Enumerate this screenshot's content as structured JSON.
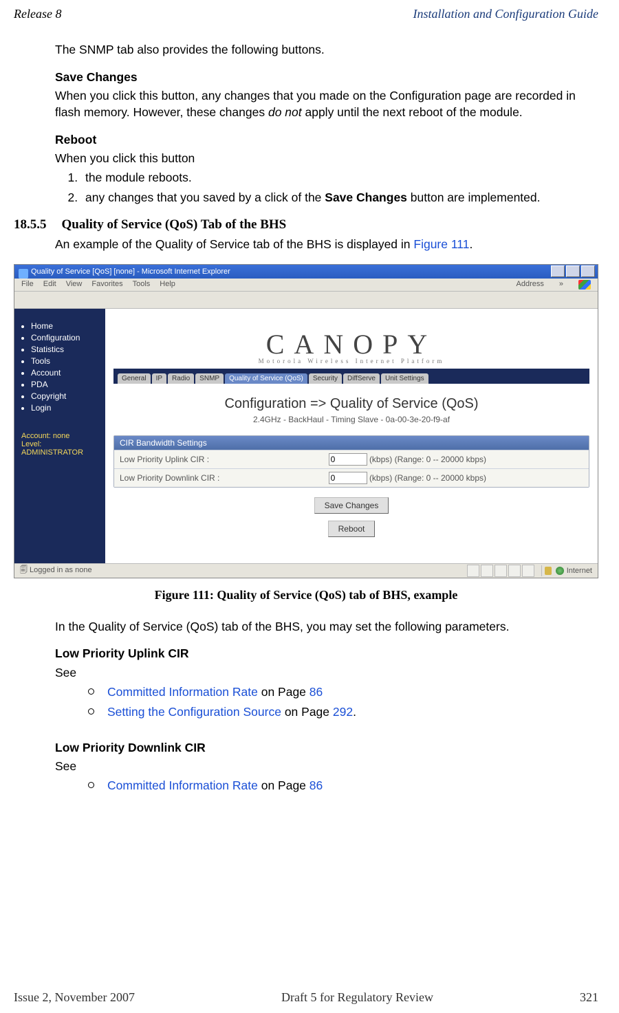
{
  "header": {
    "left": "Release 8",
    "right": "Installation and Configuration Guide"
  },
  "footer": {
    "left": "Issue 2, November 2007",
    "center": "Draft 5 for Regulatory Review",
    "right": "321"
  },
  "p1": "The SNMP tab also provides the following buttons.",
  "sh_save": "Save Changes",
  "p_save_a": "When you click this button, any changes that you made on the Configuration page are recorded in flash memory. However, these changes ",
  "p_save_i": "do not",
  "p_save_b": " apply until the next reboot of the module.",
  "sh_reboot": "Reboot",
  "p_reboot_intro": "When you click this button",
  "ol1": "the module reboots.",
  "ol2_a": "any changes that you saved by a click of the ",
  "ol2_b": "Save Changes",
  "ol2_c": " button are implemented.",
  "secnum": "18.5.5",
  "sectitle": "Quality of Service (QoS) Tab of the BHS",
  "p_sec_a": "An example of the Quality of Service tab of the BHS is displayed in ",
  "p_sec_link": "Figure 111",
  "p_sec_b": ".",
  "figcap": "Figure 111: Quality of Service (QoS) tab of BHS, example",
  "p_after": "In the Quality of Service (QoS) tab of the BHS, you may set the following parameters.",
  "sh_lpu": "Low Priority Uplink CIR",
  "see": "See",
  "b1_link": "Committed Information Rate",
  "b1_txt": " on Page ",
  "b1_pg": "86",
  "b2_link": "Setting the Configuration Source",
  "b2_txt": " on Page ",
  "b2_pg": "292",
  "period": ".",
  "sh_lpd": "Low Priority Downlink CIR",
  "ie": {
    "title": "Quality of Service [QoS] [none] - Microsoft Internet Explorer",
    "menu": [
      "File",
      "Edit",
      "View",
      "Favorites",
      "Tools",
      "Help"
    ],
    "addr": "Address",
    "chev": "»",
    "nav": [
      "Home",
      "Configuration",
      "Statistics",
      "Tools",
      "Account",
      "PDA",
      "Copyright",
      "Login"
    ],
    "acct1": "Account: none",
    "acct2": "Level: ADMINISTRATOR",
    "logo": "CANOPY",
    "tagline": "Motorola Wireless Internet Platform",
    "tabs": [
      "General",
      "IP",
      "Radio",
      "SNMP",
      "Quality of Service (QoS)",
      "Security",
      "DiffServe",
      "Unit Settings"
    ],
    "active_tab": 4,
    "cfg_title": "Configuration => Quality of Service (QoS)",
    "cfg_sub": "2.4GHz - BackHaul - Timing Slave - 0a-00-3e-20-f9-af",
    "panel_hd": "CIR Bandwidth Settings",
    "row1_lbl": "Low Priority Uplink CIR :",
    "row1_val": "0",
    "row1_help": "(kbps) (Range: 0 -- 20000 kbps)",
    "row2_lbl": "Low Priority Downlink CIR :",
    "row2_val": "0",
    "row2_help": "(kbps) (Range: 0 -- 20000 kbps)",
    "btn_save": "Save Changes",
    "btn_reboot": "Reboot",
    "status_left": "Logged in as none",
    "status_right": "Internet"
  }
}
